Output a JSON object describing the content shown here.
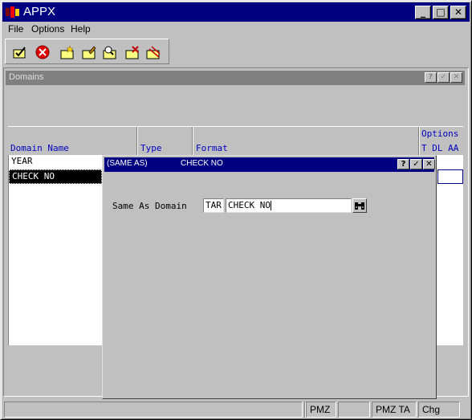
{
  "window": {
    "title": "APPX"
  },
  "title_buttons": {
    "minimize": "_",
    "maximize": "□",
    "close": "✕"
  },
  "menu": [
    "File",
    "Options",
    "Help"
  ],
  "toolbar": {
    "icons": [
      "check-folder-icon",
      "cancel-icon",
      "new-folder-icon",
      "edit-folder-icon",
      "search-folder-icon",
      "delete-folder-icon",
      "clear-folder-icon"
    ]
  },
  "domains_window": {
    "title": "Domains",
    "btn_help": "?",
    "btn_check": "✓",
    "btn_close": "✕"
  },
  "grid": {
    "headers": {
      "domain_name": "Domain Name",
      "type": "Type",
      "format": "Format",
      "options": "Options",
      "options_sub": "T DL AA"
    },
    "rows": [
      {
        "name": "YEAR"
      },
      {
        "name": "CHECK NO"
      }
    ]
  },
  "dialog": {
    "title_left": "(SAME AS)",
    "title_right": "CHECK NO",
    "btn_help": "?",
    "btn_check": "✓",
    "btn_close": "✕",
    "label": "Same As Domain",
    "field_app": "TAR",
    "field_domain": "CHECK NO"
  },
  "statusbar": [
    "",
    "",
    "PMZ",
    "",
    "PMZ TA",
    "Chg"
  ],
  "colors": {
    "titlebar": "#000080",
    "face": "#c0c0c0",
    "header_text": "#0000c0"
  }
}
